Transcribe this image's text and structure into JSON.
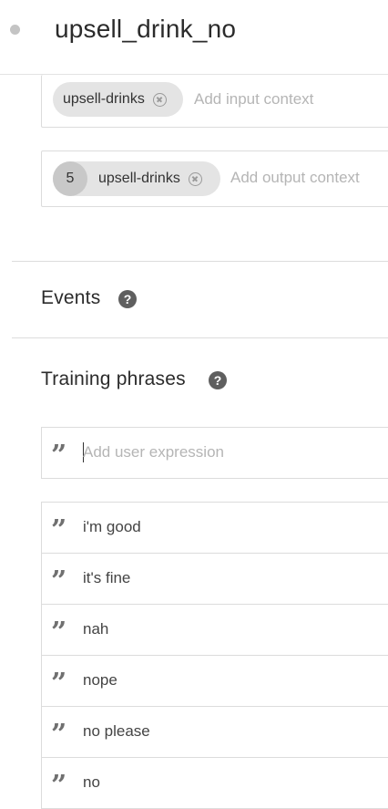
{
  "intent": {
    "title": "upsell_drink_no"
  },
  "contexts": {
    "input": {
      "chip": "upsell-drinks",
      "placeholder": "Add input context"
    },
    "output": {
      "lifespan": "5",
      "chip": "upsell-drinks",
      "placeholder": "Add output context"
    }
  },
  "events": {
    "title": "Events",
    "help": "?"
  },
  "training": {
    "title": "Training phrases",
    "help": "?",
    "quote_glyph": "”",
    "placeholder": "Add user expression",
    "phrases": [
      "i'm good",
      "it's fine",
      "nah",
      "nope",
      "no please",
      "no"
    ]
  },
  "colors": {
    "chip_bg": "#e4e4e4",
    "lifespan_bg": "#c8c8c8",
    "help_bg": "#5f5f5f",
    "divider": "#dcdcdc"
  }
}
